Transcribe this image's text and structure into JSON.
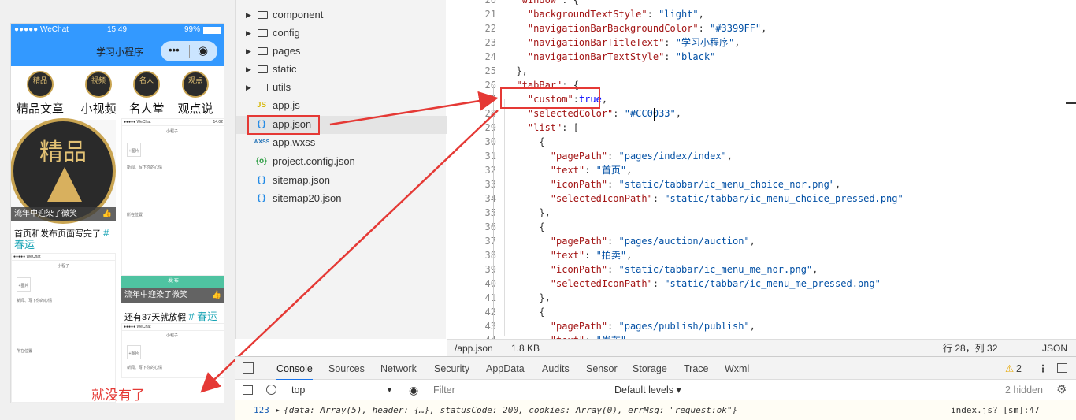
{
  "phone": {
    "status": {
      "carrier": "●●●●● WeChat",
      "time": "15:49",
      "battery": "99%"
    },
    "nav_title": "学习小程序",
    "capsule_more": "•••",
    "capsule_close": "◉",
    "categories": [
      {
        "icon_text": "精品",
        "label": "精品文章"
      },
      {
        "icon_text": "视频",
        "label": "小视频"
      },
      {
        "icon_text": "名人",
        "label": "名人堂"
      },
      {
        "icon_text": "观点",
        "label": "观点说"
      }
    ],
    "big_badge_text": "精品",
    "card1_bar": "流年中迎染了微笑",
    "card1_text": "首页和发布页面写完了",
    "card1_tag": "# 春运",
    "card2_bar": "流年中迎染了微笑",
    "card2_text": "还有37天就放假",
    "card2_tag": "# 春运",
    "publish_bar": "发 布",
    "mini_title": "小程子",
    "mini_status": "●●●●● WeChat",
    "mini_time": "14:02",
    "mini_prompt": "新闻、写下你的心情",
    "mini_add": "+图片",
    "mini_location": "所在位置",
    "empty_note": "就没有了"
  },
  "tree": {
    "items": [
      {
        "kind": "folder",
        "name": "component"
      },
      {
        "kind": "folder",
        "name": "config"
      },
      {
        "kind": "folder",
        "name": "pages"
      },
      {
        "kind": "folder",
        "name": "static"
      },
      {
        "kind": "folder",
        "name": "utils"
      },
      {
        "kind": "js",
        "icon": "JS",
        "name": "app.js"
      },
      {
        "kind": "json",
        "icon": "{ }",
        "name": "app.json"
      },
      {
        "kind": "wxss",
        "icon": "WXSS",
        "name": "app.wxss"
      },
      {
        "kind": "config",
        "icon": "{o}",
        "name": "project.config.json"
      },
      {
        "kind": "json",
        "icon": "{ }",
        "name": "sitemap.json"
      },
      {
        "kind": "json",
        "icon": "{ }",
        "name": "sitemap20.json"
      }
    ]
  },
  "editor": {
    "lines": [
      {
        "n": "20",
        "t": "  \"window\": {"
      },
      {
        "n": "21",
        "t": "    \"backgroundTextStyle\": \"light\","
      },
      {
        "n": "22",
        "t": "    \"navigationBarBackgroundColor\": \"#3399FF\","
      },
      {
        "n": "23",
        "t": "    \"navigationBarTitleText\": \"学习小程序\","
      },
      {
        "n": "24",
        "t": "    \"navigationBarTextStyle\": \"black\""
      },
      {
        "n": "25",
        "t": "  },"
      },
      {
        "n": "26",
        "t": "  \"tabBar\": {"
      },
      {
        "n": "27",
        "t": "    \"custom\":true,"
      },
      {
        "n": "28",
        "t": "    \"selectedColor\": \"#CC0033\","
      },
      {
        "n": "29",
        "t": "    \"list\": ["
      },
      {
        "n": "30",
        "t": "      {"
      },
      {
        "n": "31",
        "t": "        \"pagePath\": \"pages/index/index\","
      },
      {
        "n": "32",
        "t": "        \"text\": \"首页\","
      },
      {
        "n": "33",
        "t": "        \"iconPath\": \"static/tabbar/ic_menu_choice_nor.png\","
      },
      {
        "n": "34",
        "t": "        \"selectedIconPath\": \"static/tabbar/ic_menu_choice_pressed.png\""
      },
      {
        "n": "35",
        "t": "      },"
      },
      {
        "n": "36",
        "t": "      {"
      },
      {
        "n": "37",
        "t": "        \"pagePath\": \"pages/auction/auction\","
      },
      {
        "n": "38",
        "t": "        \"text\": \"拍卖\","
      },
      {
        "n": "39",
        "t": "        \"iconPath\": \"static/tabbar/ic_menu_me_nor.png\","
      },
      {
        "n": "40",
        "t": "        \"selectedIconPath\": \"static/tabbar/ic_menu_me_pressed.png\""
      },
      {
        "n": "41",
        "t": "      },"
      },
      {
        "n": "42",
        "t": "      {"
      },
      {
        "n": "43",
        "t": "        \"pagePath\": \"pages/publish/publish\","
      },
      {
        "n": "44",
        "t": "        \"text\": \"发布\","
      }
    ],
    "status": {
      "path": "/app.json",
      "size": "1.8 KB",
      "position": "行 28，列 32",
      "lang": "JSON"
    }
  },
  "devtools": {
    "tabs": [
      "Console",
      "Sources",
      "Network",
      "Security",
      "AppData",
      "Audits",
      "Sensor",
      "Storage",
      "Trace",
      "Wxml"
    ],
    "warning_count": "2",
    "context": "top",
    "filter_placeholder": "Filter",
    "levels": "Default levels ▾",
    "hidden": "2 hidden",
    "log": {
      "line_no": "123",
      "message": "{data: Array(5), header: {…}, statusCode: 200, cookies: Array(0), errMsg: \"request:ok\"}",
      "source": "index.js? [sm]:47"
    }
  },
  "colors": {
    "nav_blue": "#3399ff",
    "annotation_red": "#e53935",
    "console_active": "#1a73e8"
  }
}
